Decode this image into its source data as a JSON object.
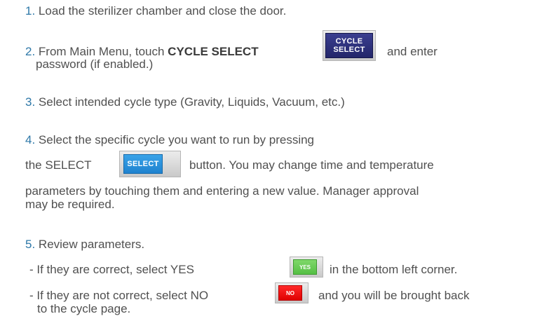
{
  "steps": [
    {
      "number": "1.",
      "text": "Load the sterilizer chamber and close the door."
    },
    {
      "number": "2.",
      "text_pre": "From Main Menu, touch",
      "text_bold": "CYCLE SELECT",
      "text_post": "and enter",
      "text_line2": "password (if enabled.)",
      "button_line1": "CYCLE",
      "button_line2": "SELECT"
    },
    {
      "number": "3.",
      "text": "Select intended cycle type (Gravity, Liquids, Vacuum, etc.)"
    },
    {
      "number": "4.",
      "text": "Select the specific cycle you want to run by pressing",
      "text_pre2": "the SELECT",
      "button_label": "SELECT",
      "text_post2": "button. You may change time and temperature",
      "text_line3": "parameters by touching them and entering a new value. Manager approval",
      "text_line4": "may be required."
    },
    {
      "number": "5.",
      "text": "Review parameters.",
      "sub_yes_pre": "- If they are correct, select YES",
      "yes_label": "YES",
      "sub_yes_post": "in the bottom left corner.",
      "sub_no_pre": "- If they are not correct, select NO",
      "no_label": "NO",
      "sub_no_post": "and you will be brought back",
      "sub_no_line2": "to the cycle page."
    }
  ],
  "colors": {
    "number": "#2e78a8",
    "text": "#505050",
    "cycle_select_button": "#2e3280",
    "select_button": "#2b93dd",
    "yes_button": "#66c852",
    "no_button": "#f00000"
  }
}
